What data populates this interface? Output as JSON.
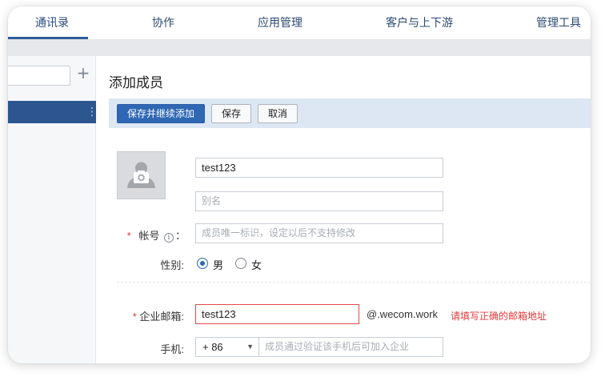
{
  "nav": {
    "tabs": [
      {
        "label": "通讯录",
        "active": true
      },
      {
        "label": "协作",
        "active": false
      },
      {
        "label": "应用管理",
        "active": false
      },
      {
        "label": "客户与上下游",
        "active": false
      },
      {
        "label": "管理工具",
        "active": false
      }
    ]
  },
  "sidebar": {
    "search_value": "",
    "add_icon": "plus-icon",
    "selected_item_menu_icon": "vertical-dots-icon"
  },
  "main": {
    "title": "添加成员",
    "toolbar": {
      "save_continue": "保存并继续添加",
      "save": "保存",
      "cancel": "取消"
    },
    "avatar_icon": "user-avatar-icon",
    "name_value": "test123",
    "alias_placeholder": "别名",
    "account": {
      "label": "帐号",
      "colon": "：",
      "required_mark": "*",
      "info_icon": "i",
      "placeholder": "成员唯一标识，设定以后不支持修改"
    },
    "gender": {
      "label": "性别:",
      "male": "男",
      "female": "女",
      "selected": "男"
    },
    "email": {
      "required_mark": "*",
      "label": "企业邮箱:",
      "value": "test123",
      "domain": "@.wecom.work",
      "error": "请填写正确的邮箱地址"
    },
    "phone": {
      "label": "手机:",
      "country_code": "+ 86",
      "placeholder": "成员通过验证该手机后可加入企业"
    }
  },
  "colors": {
    "primary": "#2e67b4",
    "nav_text": "#2e4b73",
    "sidebar_selected": "#2d5590",
    "error": "#e23b3b",
    "toolbar_bg": "#dde7f3"
  }
}
